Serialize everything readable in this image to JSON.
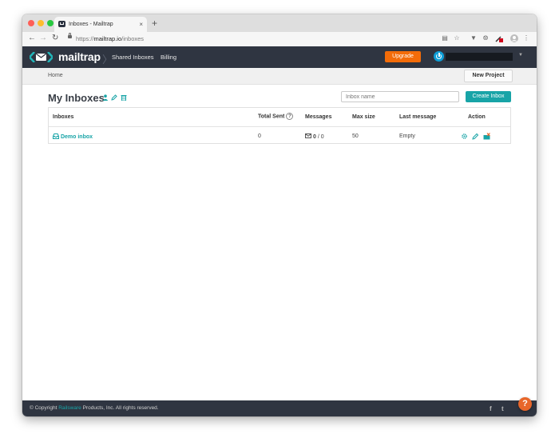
{
  "browser": {
    "tab_title": "Inboxes - Mailtrap",
    "tab_close": "×",
    "new_tab": "+",
    "url_scheme": "https://",
    "url_host": "mailtrap.io",
    "url_path": "/inboxes",
    "icons": [
      "back-arrow-icon",
      "forward-arrow-icon",
      "reload-icon",
      "lock-icon",
      "translate-icon",
      "star-icon",
      "vpn-icon",
      "extension-icon",
      "extension-badge-icon",
      "profile-icon",
      "menu-icon"
    ]
  },
  "appbar": {
    "logo_text": "mailtrap",
    "nav": [
      "Shared Inboxes",
      "Billing"
    ],
    "upgrade_label": "Upgrade",
    "accent": "#f36c09"
  },
  "breadcrumb": {
    "home": "Home",
    "new_project_label": "New Project"
  },
  "page": {
    "title": "My Inboxes",
    "search_placeholder": "Inbox name",
    "create_label": "Create Inbox",
    "accent": "#18a4a7"
  },
  "table": {
    "headers": {
      "inboxes": "Inboxes",
      "total_sent": "Total Sent",
      "total_sent_help": "?",
      "messages": "Messages",
      "max_size": "Max size",
      "last_message": "Last message",
      "action": "Action"
    },
    "rows": [
      {
        "name": "Demo inbox",
        "total_sent": "0",
        "messages_read": "0",
        "messages_sep": "/",
        "messages_total": "0",
        "max_size": "50",
        "last_message": "Empty"
      }
    ]
  },
  "footer": {
    "copyright_prefix": "© Copyright",
    "company": "Railsware",
    "copyright_suffix": "Products, Inc. All rights reserved.",
    "social": [
      "f",
      "t"
    ],
    "help_label": "?"
  }
}
